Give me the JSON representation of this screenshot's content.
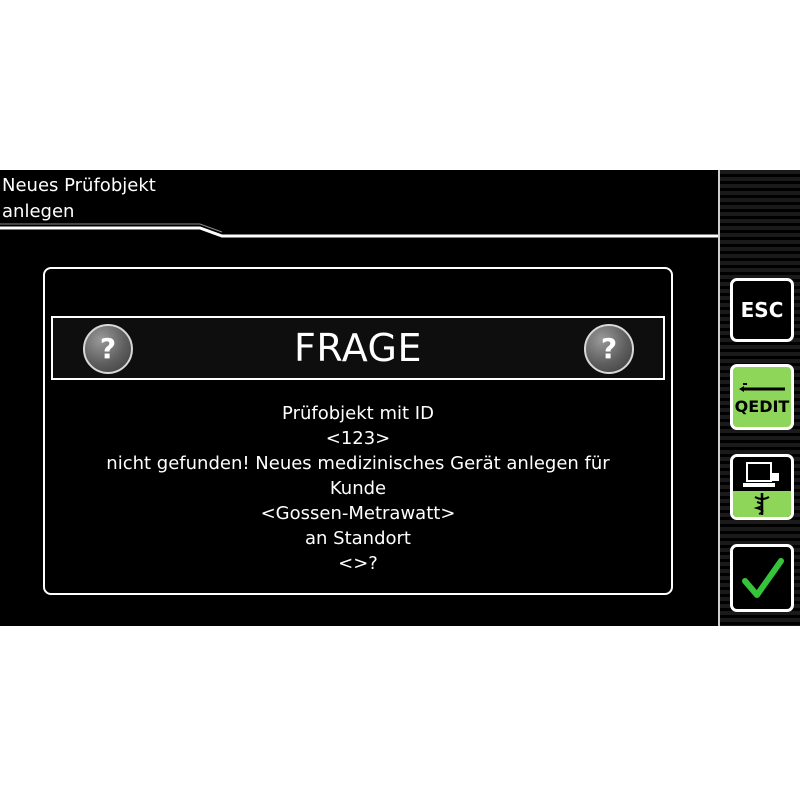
{
  "header": {
    "title_line1": "Neues Prüfobjekt",
    "title_line2": "anlegen"
  },
  "dialog": {
    "title": "FRAGE",
    "icon_glyph": "?",
    "message_lines": [
      "Prüfobjekt mit ID",
      "<123>",
      "nicht gefunden! Neues medizinisches Gerät anlegen für",
      "Kunde",
      "<Gossen-Metrawatt>",
      "an Standort",
      "<>?"
    ]
  },
  "side_buttons": {
    "esc_label": "ESC",
    "qedit_label": "QEDIT",
    "device_icon": "computer-medical-icon",
    "confirm_icon": "checkmark-icon"
  },
  "colors": {
    "background": "#000000",
    "accent_green": "#8ed65a",
    "foreground": "#ffffff"
  }
}
